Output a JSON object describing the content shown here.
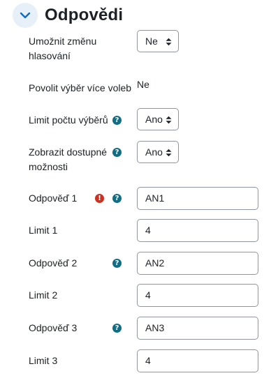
{
  "section": {
    "title": "Odpovědi",
    "collapse_icon": "chevron-down-icon"
  },
  "fields": {
    "allow_update": {
      "label": "Umožnit změnu hlasování",
      "value": "Ne"
    },
    "allow_multiple": {
      "label": "Povolit výběr více voleb",
      "value": "Ne"
    },
    "limit_answers": {
      "label": "Limit počtu výběrů",
      "value": "Ano"
    },
    "show_available": {
      "label": "Zobrazit dostupné možnosti",
      "value": "Ano"
    },
    "option1": {
      "label": "Odpověď 1",
      "value": "AN1"
    },
    "limit1": {
      "label": "Limit 1",
      "value": "4"
    },
    "option2": {
      "label": "Odpověď 2",
      "value": "AN2"
    },
    "limit2": {
      "label": "Limit 2",
      "value": "4"
    },
    "option3": {
      "label": "Odpověď 3",
      "value": "AN3"
    },
    "limit3": {
      "label": "Limit 3",
      "value": "4"
    }
  },
  "icons": {
    "help": "?",
    "error": "!"
  },
  "colors": {
    "help_icon": "#0f6e84",
    "error_icon": "#ca3120",
    "accent": "#0f6cbf"
  }
}
